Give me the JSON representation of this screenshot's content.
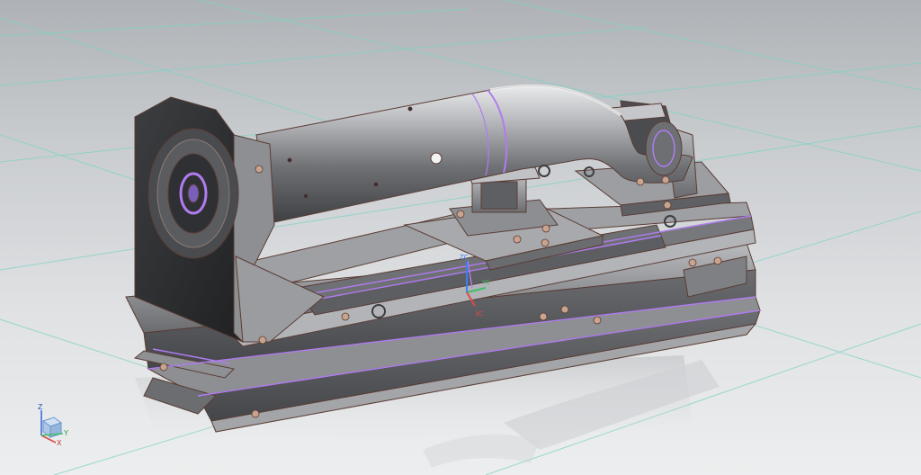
{
  "viewport": {
    "name": "3d-cad-viewport",
    "colors": {
      "background_top": "#aeb2b6",
      "background_bottom": "#eceeef",
      "grid": "#7fd2c4",
      "metal": "#8c8e92",
      "highlight": "#b07cf0",
      "edge": "#5a3d34"
    }
  },
  "wcs": {
    "x_label": "XC",
    "y_label": "YC",
    "z_label": "ZC"
  },
  "view_triad": {
    "z_label": "Z",
    "x_label": "X",
    "y_label": "Y"
  }
}
